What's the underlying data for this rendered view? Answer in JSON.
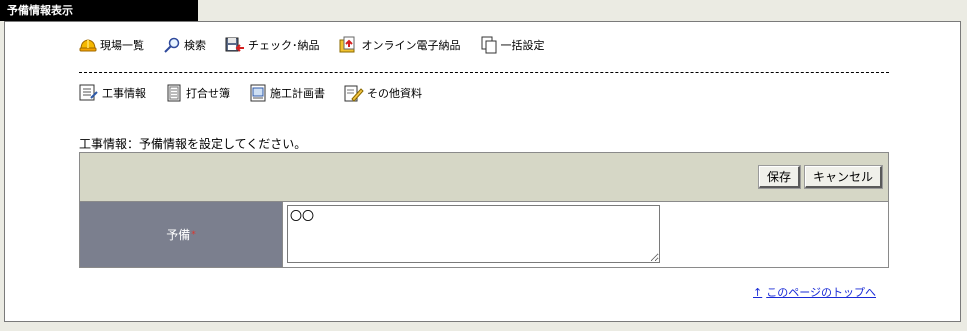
{
  "window": {
    "title": "予備情報表示"
  },
  "nav_primary": [
    {
      "label": "現場一覧",
      "icon": "hardhat-icon"
    },
    {
      "label": "検索",
      "icon": "magnifier-icon"
    },
    {
      "label": "チェック･納品",
      "icon": "floppy-icon"
    },
    {
      "label": "オンライン電子納品",
      "icon": "upload-folder-icon"
    },
    {
      "label": "一括設定",
      "icon": "pages-icon"
    }
  ],
  "nav_secondary": [
    {
      "label": "工事情報",
      "icon": "list-doc-icon"
    },
    {
      "label": "打合せ簿",
      "icon": "notebook-icon"
    },
    {
      "label": "施工計画書",
      "icon": "plan-doc-icon"
    },
    {
      "label": "その他資料",
      "icon": "edit-doc-icon"
    }
  ],
  "message": "工事情報：予備情報を設定してください。",
  "toolbar": {
    "save_label": "保存",
    "cancel_label": "キャンセル"
  },
  "form": {
    "field_label": "予備",
    "required_mark": "*",
    "field_value": "〇〇"
  },
  "footer": {
    "page_top_label": "このページのトップへ",
    "page_top_arrow": "↑"
  },
  "colors": {
    "toolbar_bg": "#d6d7c6",
    "label_bg": "#7b7f8e",
    "link": "#1a2bd6",
    "title_bg": "#000000"
  }
}
